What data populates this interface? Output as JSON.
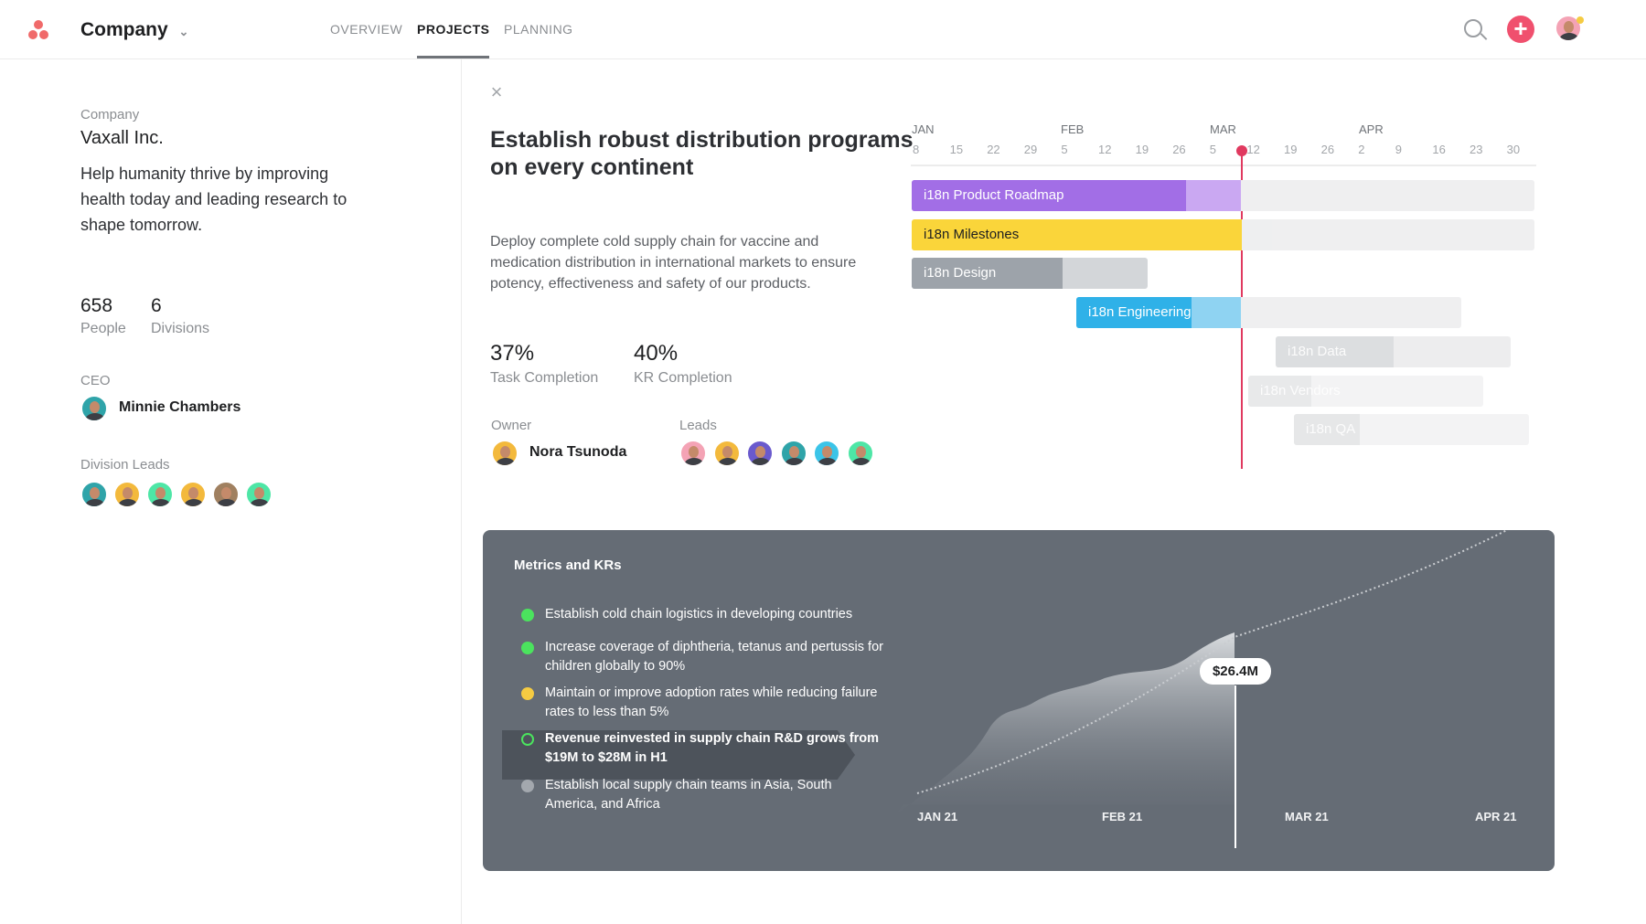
{
  "header": {
    "workspace": "Company",
    "tabs": [
      "OVERVIEW",
      "PROJECTS",
      "PLANNING"
    ],
    "active_tab": "PROJECTS",
    "icons": [
      "search-icon",
      "plus-icon",
      "user-avatar"
    ],
    "brand_color": "#f06a6a"
  },
  "company": {
    "label": "Company",
    "name": "Vaxall Inc.",
    "mission": "Help humanity thrive by improving health today and leading research to shape tomorrow.",
    "stats": [
      {
        "value": "658",
        "label": "People"
      },
      {
        "value": "6",
        "label": "Divisions"
      }
    ],
    "ceo_label": "CEO",
    "ceo": "Minnie Chambers",
    "division_leads_label": "Division Leads",
    "division_leads_count": 6
  },
  "project": {
    "title": "Establish robust distribution programs on every continent",
    "description": "Deploy complete cold supply chain for vaccine and medication distribution in international markets to ensure potency, effectiveness and safety of our products.",
    "stats": [
      {
        "value": "37%",
        "label": "Task Completion"
      },
      {
        "value": "40%",
        "label": "KR Completion"
      }
    ],
    "owner_label": "Owner",
    "owner": "Nora Tsunoda",
    "leads_label": "Leads",
    "leads_colors": [
      "#f4a3b5",
      "#f3b93c",
      "#6a5acd",
      "#2fa4a9",
      "#3bc4e8",
      "#4ee6a6"
    ]
  },
  "timeline": {
    "months": [
      "JAN",
      "FEB",
      "MAR",
      "APR"
    ],
    "days": [
      "8",
      "15",
      "22",
      "29",
      "5",
      "12",
      "19",
      "26",
      "5",
      "12",
      "19",
      "26",
      "2",
      "9",
      "16",
      "23",
      "30"
    ],
    "today": "MAR 10",
    "bars": [
      {
        "name": "i18n Product Roadmap",
        "color": "#a26ee6",
        "light": "#caa8f2",
        "progress": 0.44
      },
      {
        "name": "i18n Milestones",
        "color": "#fad53a",
        "light": "#eeeff0",
        "progress": 0.53
      },
      {
        "name": "i18n Design",
        "color": "#9da3aa",
        "light": "#d3d6d9",
        "progress": 0.64
      },
      {
        "name": "i18n Engineering",
        "color": "#2fb1e8",
        "light": "#8fd3f2",
        "progress": 0.3
      },
      {
        "name": "i18n Data",
        "color": "#dcdee0",
        "light": "#ededee",
        "progress": 0.5
      },
      {
        "name": "i18n Vendors",
        "color": "#e8e9ea",
        "light": "#f3f3f4",
        "progress": 0.27
      },
      {
        "name": "i18n QA",
        "color": "#e6e7e8",
        "light": "#f3f3f4",
        "progress": 0.28
      }
    ]
  },
  "metrics": {
    "title": "Metrics and KRs",
    "items": [
      {
        "text": "Establish cold chain logistics in developing countries",
        "status": "#4be35e"
      },
      {
        "text": "Increase coverage of diphtheria, tetanus and pertussis for children globally to 90%",
        "status": "#4be35e"
      },
      {
        "text": "Maintain or improve adoption rates while reducing failure rates to less than 5%",
        "status": "#f5cb42"
      },
      {
        "text": "Revenue reinvested in supply chain R&D grows from $19M to $28M in H1",
        "status": "#4be35e",
        "selected": true
      },
      {
        "text": "Establish local supply chain teams in Asia, South America, and Africa",
        "status": "#a3a8ae"
      }
    ],
    "chart": {
      "x_labels": [
        "JAN 21",
        "FEB 21",
        "MAR 21",
        "APR 21"
      ],
      "current_value": "$26.4M"
    }
  }
}
